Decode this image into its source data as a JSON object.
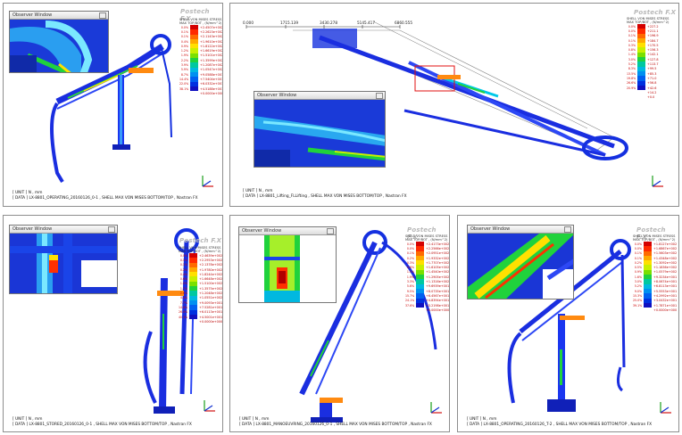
{
  "brand": "Postech F.X",
  "observer_title": "Observer Window",
  "units": "[ UNIT ] N ,   mm",
  "legend_title_a": "SHELL VON MISES STRESS",
  "legend_title_b": "MAX TOP/BOT , (N/mm^2)",
  "colors": [
    "#d40000",
    "#ff2a00",
    "#ff6a00",
    "#ffa800",
    "#ffe000",
    "#c8f000",
    "#7ae000",
    "#20d23c",
    "#00c8a0",
    "#00b8e0",
    "#0090f0",
    "#0060f0",
    "#0030e0",
    "#1010c0"
  ],
  "panels": [
    {
      "data_line": "[ DATA ] LX-8801_OPERATING_20160126_0-1 ,  SHELL MAX VON MISES BOTTOM/TOP , Nastran FX",
      "legend_pct": [
        "0.0%",
        "0.1%",
        "0.1%",
        "0.4%",
        "0.9%",
        "1.2%",
        "1.9%",
        "2.2%",
        "3.9%",
        "5.9%",
        "8.7%",
        "14.4%",
        "22.0%",
        "38.1%"
      ],
      "legend_vals": [
        "+2.4507e+002",
        "+2.2623e+002",
        "+2.1143e+002",
        "+1.9610e+002",
        "+1.8122e+002",
        "+1.6619e+002",
        "+1.5101e+002",
        "+1.3599e+002",
        "+1.2087e+002",
        "+1.0547e+002",
        "+9.0588e+001",
        "+7.5404e+001",
        "+6.0332e+001",
        "+4.5188e+001"
      ],
      "legend_last": "+0.0000e+000"
    },
    {
      "data_line": "[ DATA ] LX-8801_Lifting_FLLifting ,  SHELL MAX VON MISES BOTTOM/TOP , Nastran FX",
      "legend_pct": [
        "0.0%",
        "0.0%",
        "0.1%",
        "0.1%",
        "0.3%",
        "0.8%",
        "1.4%",
        "3.0%",
        "5.2%",
        "8.3%",
        "13.5%",
        "19.8%",
        "26.6%",
        "20.9%"
      ],
      "legend_vals": [
        "+227.2",
        "+211.1",
        "+196.9",
        "+184.7",
        "+170.5",
        "+156.3",
        "+142.1",
        "+127.8",
        "+113.7",
        "+99.5",
        "+85.3",
        "+71.0",
        "+56.8",
        "+42.6"
      ],
      "legend_last": "+14.2",
      "legend_tail": "+0.0",
      "scale_ticks": [
        "0.000",
        "1715.139",
        "3430.278",
        "5145.417",
        "6860.555"
      ]
    },
    {
      "data_line": "[ DATA ] LX-8801_STORED_20160126_0-1 ,  SHELL MAX VON MISES BOTTOM/TOP , Nastran FX",
      "legend_pct": [
        "0.0%",
        "0.1%",
        "0.1%",
        "0.2%",
        "0.4%",
        "0.6%",
        "1.0%",
        "1.7%",
        "2.6%",
        "4.4%",
        "7.7%",
        "14.6%",
        "26.0%",
        "40.3%"
      ],
      "legend_vals": [
        "+2.4639e+002",
        "+2.2953e+002",
        "+2.1378e+002",
        "+1.9780e+002",
        "+1.8244e+002",
        "+1.6648e+002",
        "+1.5100e+002",
        "+1.3575e+002",
        "+1.2048e+002",
        "+1.0551e+002",
        "+9.0093e+001",
        "+7.5281e+001",
        "+6.0113e+001",
        "+4.5001e+001"
      ],
      "legend_last": "+0.0000e+000"
    },
    {
      "data_line": "[ DATA ] LX-8801_MANOEUVRING_20160126_0-1 ,  SHELL MAX VON MISES BOTTOM/TOP , Nastran FX",
      "legend_pct": [
        "0.0%",
        "0.0%",
        "0.1%",
        "0.2%",
        "0.3%",
        "0.6%",
        "1.1%",
        "1.9%",
        "3.3%",
        "5.6%",
        "9.5%",
        "15.7%",
        "24.1%",
        "37.6%"
      ],
      "legend_vals": [
        "+2.4173e+002",
        "+2.2566e+002",
        "+2.0951e+002",
        "+1.9332e+002",
        "+1.7707e+002",
        "+1.6105e+002",
        "+1.4540e+002",
        "+1.2905e+002",
        "+1.1316e+002",
        "+9.6939e+001",
        "+8.0735e+001",
        "+6.4567e+001",
        "+4.8394e+001",
        "+3.2198e+001"
      ],
      "legend_last": "+0.0000e+000"
    },
    {
      "data_line": "[ DATA ] LX-8801_OPERATING_20160126_T-2 ,  SHELL MAX VON MISES BOTTOM/TOP , Nastran FX",
      "legend_pct": [
        "0.0%",
        "0.0%",
        "0.1%",
        "0.1%",
        "0.2%",
        "0.5%",
        "0.9%",
        "1.6%",
        "3.0%",
        "5.2%",
        "9.0%",
        "15.3%",
        "25.0%",
        "39.1%"
      ],
      "legend_vals": [
        "+1.8127e+002",
        "+1.6867e+002",
        "+1.5603e+002",
        "+1.4348e+002",
        "+1.3092e+002",
        "+1.1836e+002",
        "+1.0579e+002",
        "+9.3234e+001",
        "+8.0674e+001",
        "+6.8113e+001",
        "+5.5553e+001",
        "+4.2992e+001",
        "+3.0432e+001",
        "+1.7871e+001"
      ],
      "legend_last": "+0.0000e+000"
    }
  ]
}
